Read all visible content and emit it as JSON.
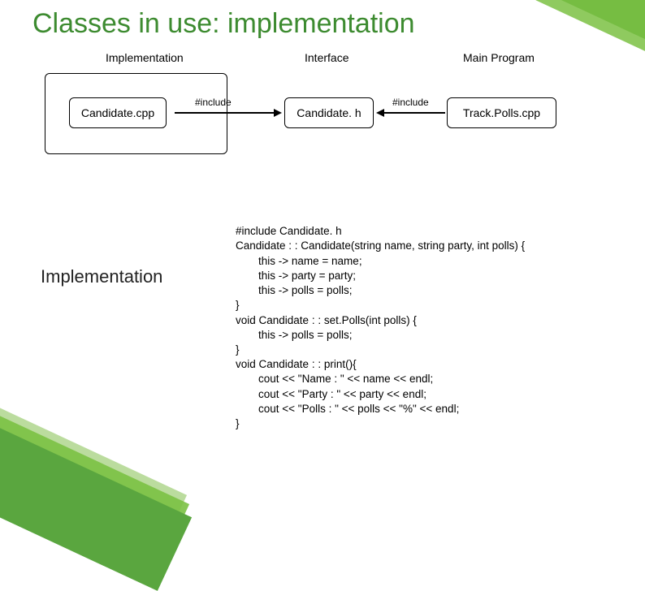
{
  "title": "Classes in use: implementation",
  "diagram": {
    "sections": {
      "implementation": "Implementation",
      "interface": "Interface",
      "main": "Main Program"
    },
    "boxes": {
      "candidate_cpp": "Candidate.cpp",
      "candidate_h": "Candidate. h",
      "trackpolls_cpp": "Track.Polls.cpp"
    },
    "arrow_label": "#include"
  },
  "section_heading": "Implementation",
  "code": {
    "l1": "#include Candidate. h",
    "l2": "Candidate : : Candidate(string name, string party, int polls) {",
    "l3": "this -> name = name;",
    "l4": "this -> party = party;",
    "l5": "this -> polls = polls;",
    "l6": "}",
    "l7": "void Candidate : : set.Polls(int polls) {",
    "l8": "this -> polls = polls;",
    "l9": "}",
    "l10": "void Candidate : : print(){",
    "l11": "cout << \"Name : \" << name << endl;",
    "l12": "cout << \"Party : \" << party << endl;",
    "l13": "cout << \"Polls : \" << polls << \"%\" << endl;",
    "l14": "}"
  }
}
